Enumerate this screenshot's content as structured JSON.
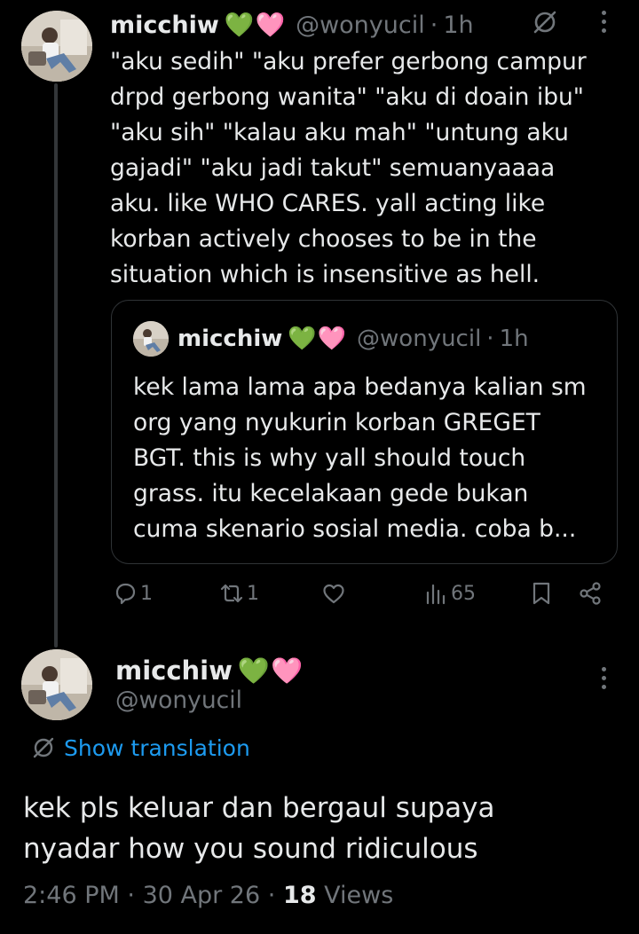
{
  "quoting_tweet": {
    "display_name": "micchiw",
    "emojis": [
      "💚",
      "🩷"
    ],
    "handle": "@wonyucil",
    "separator": "·",
    "time": "1h",
    "text_lines": [
      "\"aku sedih\" \"aku prefer gerbong campur",
      "drpd gerbong wanita\" \"aku di doain ibu\"",
      "\"aku sih\" \"kalau aku mah\" \"untung aku",
      "gajadi\" \"aku jadi takut\" semuanyaaaa",
      "aku. like WHO CARES. yall acting like",
      "korban actively chooses to be in the",
      "situation which is insensitive as hell."
    ],
    "quoted_tweet": {
      "display_name": "micchiw",
      "emojis": [
        "💚",
        "🩷"
      ],
      "handle": "@wonyucil",
      "separator": "·",
      "time": "1h",
      "text_lines": [
        "kek lama lama apa bedanya kalian sm",
        "org yang nyukurin korban GREGET",
        "BGT. this is why yall should touch",
        "grass. itu kecelakaan gede bukan",
        "cuma skenario sosial media. coba b..."
      ]
    },
    "actions": {
      "replies": "1",
      "reposts": "1",
      "likes": "",
      "views": "65"
    }
  },
  "main_tweet": {
    "display_name": "micchiw",
    "emojis": [
      "💚",
      "🩷"
    ],
    "handle": "@wonyucil",
    "show_translation_label": "Show translation",
    "text_lines": [
      "kek pls keluar dan bergaul supaya",
      "nyadar how you sound ridiculous"
    ],
    "time": "2:46 PM",
    "date": "30 Apr 26",
    "separator": "·",
    "views_count": "18",
    "views_label": "Views"
  },
  "colors": {
    "background": "#000000",
    "text": "#e7e9ea",
    "secondary": "#71767b",
    "link": "#1d9bf0",
    "border": "#2f3336"
  },
  "icons": [
    "translate-icon",
    "more-icon",
    "reply-icon",
    "repost-icon",
    "like-icon",
    "views-icon",
    "bookmark-icon",
    "share-icon"
  ]
}
